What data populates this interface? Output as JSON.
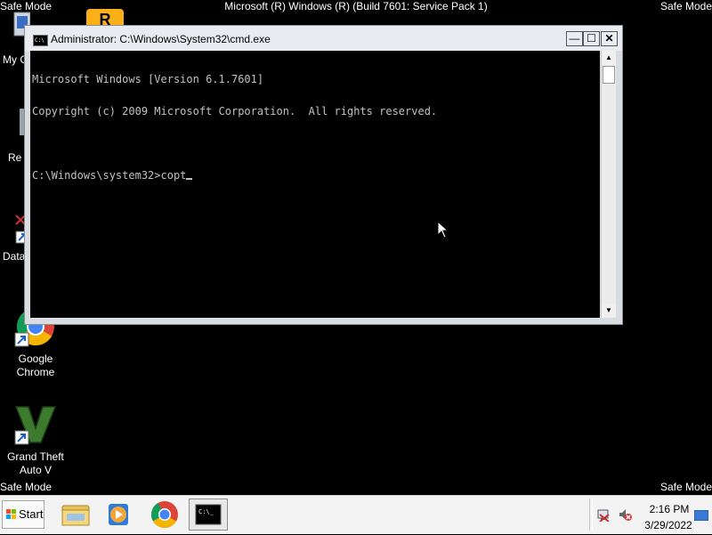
{
  "desktop": {
    "safe_mode_label": "Safe Mode",
    "build_text": "Microsoft (R) Windows (R) (Build 7601: Service Pack 1)",
    "icons": [
      {
        "label": "My C"
      },
      {
        "label": "Re"
      },
      {
        "label": "Data"
      },
      {
        "label_line1": "Google",
        "label_line2": "Chrome"
      },
      {
        "label_line1": "Grand Theft",
        "label_line2": "Auto V"
      }
    ]
  },
  "cmd_window": {
    "title": "Administrator: C:\\Windows\\System32\\cmd.exe",
    "icon_text": "C:\\",
    "buttons": {
      "minimize": "—",
      "maximize": "☐",
      "close": "✕"
    },
    "console_lines": [
      "Microsoft Windows [Version 6.1.7601]",
      "Copyright (c) 2009 Microsoft Corporation.  All rights reserved.",
      "",
      "C:\\Windows\\system32>copt"
    ],
    "scroll_up": "▲",
    "scroll_down": "▼"
  },
  "taskbar": {
    "start_label": "Start",
    "cmd_icon_text": "C:\\_",
    "clock_time": "2:16 PM",
    "clock_date": "3/29/2022"
  },
  "colors": {
    "console_text": "#c0c0c0",
    "desktop_bg": "#000000",
    "chrome_red": "#db4437",
    "chrome_green": "#0f9d58",
    "chrome_yellow": "#f4b400",
    "chrome_blue": "#4285f4",
    "gta_green": "#3c7a2e"
  }
}
